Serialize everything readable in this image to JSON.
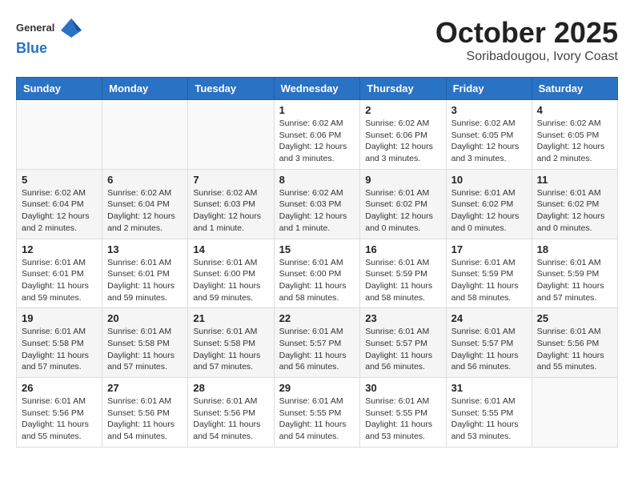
{
  "logo": {
    "general": "General",
    "blue": "Blue"
  },
  "header": {
    "month": "October 2025",
    "location": "Soribadougou, Ivory Coast"
  },
  "weekdays": [
    "Sunday",
    "Monday",
    "Tuesday",
    "Wednesday",
    "Thursday",
    "Friday",
    "Saturday"
  ],
  "weeks": [
    [
      {
        "day": "",
        "info": ""
      },
      {
        "day": "",
        "info": ""
      },
      {
        "day": "",
        "info": ""
      },
      {
        "day": "1",
        "info": "Sunrise: 6:02 AM\nSunset: 6:06 PM\nDaylight: 12 hours\nand 3 minutes."
      },
      {
        "day": "2",
        "info": "Sunrise: 6:02 AM\nSunset: 6:06 PM\nDaylight: 12 hours\nand 3 minutes."
      },
      {
        "day": "3",
        "info": "Sunrise: 6:02 AM\nSunset: 6:05 PM\nDaylight: 12 hours\nand 3 minutes."
      },
      {
        "day": "4",
        "info": "Sunrise: 6:02 AM\nSunset: 6:05 PM\nDaylight: 12 hours\nand 2 minutes."
      }
    ],
    [
      {
        "day": "5",
        "info": "Sunrise: 6:02 AM\nSunset: 6:04 PM\nDaylight: 12 hours\nand 2 minutes."
      },
      {
        "day": "6",
        "info": "Sunrise: 6:02 AM\nSunset: 6:04 PM\nDaylight: 12 hours\nand 2 minutes."
      },
      {
        "day": "7",
        "info": "Sunrise: 6:02 AM\nSunset: 6:03 PM\nDaylight: 12 hours\nand 1 minute."
      },
      {
        "day": "8",
        "info": "Sunrise: 6:02 AM\nSunset: 6:03 PM\nDaylight: 12 hours\nand 1 minute."
      },
      {
        "day": "9",
        "info": "Sunrise: 6:01 AM\nSunset: 6:02 PM\nDaylight: 12 hours\nand 0 minutes."
      },
      {
        "day": "10",
        "info": "Sunrise: 6:01 AM\nSunset: 6:02 PM\nDaylight: 12 hours\nand 0 minutes."
      },
      {
        "day": "11",
        "info": "Sunrise: 6:01 AM\nSunset: 6:02 PM\nDaylight: 12 hours\nand 0 minutes."
      }
    ],
    [
      {
        "day": "12",
        "info": "Sunrise: 6:01 AM\nSunset: 6:01 PM\nDaylight: 11 hours\nand 59 minutes."
      },
      {
        "day": "13",
        "info": "Sunrise: 6:01 AM\nSunset: 6:01 PM\nDaylight: 11 hours\nand 59 minutes."
      },
      {
        "day": "14",
        "info": "Sunrise: 6:01 AM\nSunset: 6:00 PM\nDaylight: 11 hours\nand 59 minutes."
      },
      {
        "day": "15",
        "info": "Sunrise: 6:01 AM\nSunset: 6:00 PM\nDaylight: 11 hours\nand 58 minutes."
      },
      {
        "day": "16",
        "info": "Sunrise: 6:01 AM\nSunset: 5:59 PM\nDaylight: 11 hours\nand 58 minutes."
      },
      {
        "day": "17",
        "info": "Sunrise: 6:01 AM\nSunset: 5:59 PM\nDaylight: 11 hours\nand 58 minutes."
      },
      {
        "day": "18",
        "info": "Sunrise: 6:01 AM\nSunset: 5:59 PM\nDaylight: 11 hours\nand 57 minutes."
      }
    ],
    [
      {
        "day": "19",
        "info": "Sunrise: 6:01 AM\nSunset: 5:58 PM\nDaylight: 11 hours\nand 57 minutes."
      },
      {
        "day": "20",
        "info": "Sunrise: 6:01 AM\nSunset: 5:58 PM\nDaylight: 11 hours\nand 57 minutes."
      },
      {
        "day": "21",
        "info": "Sunrise: 6:01 AM\nSunset: 5:58 PM\nDaylight: 11 hours\nand 57 minutes."
      },
      {
        "day": "22",
        "info": "Sunrise: 6:01 AM\nSunset: 5:57 PM\nDaylight: 11 hours\nand 56 minutes."
      },
      {
        "day": "23",
        "info": "Sunrise: 6:01 AM\nSunset: 5:57 PM\nDaylight: 11 hours\nand 56 minutes."
      },
      {
        "day": "24",
        "info": "Sunrise: 6:01 AM\nSunset: 5:57 PM\nDaylight: 11 hours\nand 56 minutes."
      },
      {
        "day": "25",
        "info": "Sunrise: 6:01 AM\nSunset: 5:56 PM\nDaylight: 11 hours\nand 55 minutes."
      }
    ],
    [
      {
        "day": "26",
        "info": "Sunrise: 6:01 AM\nSunset: 5:56 PM\nDaylight: 11 hours\nand 55 minutes."
      },
      {
        "day": "27",
        "info": "Sunrise: 6:01 AM\nSunset: 5:56 PM\nDaylight: 11 hours\nand 54 minutes."
      },
      {
        "day": "28",
        "info": "Sunrise: 6:01 AM\nSunset: 5:56 PM\nDaylight: 11 hours\nand 54 minutes."
      },
      {
        "day": "29",
        "info": "Sunrise: 6:01 AM\nSunset: 5:55 PM\nDaylight: 11 hours\nand 54 minutes."
      },
      {
        "day": "30",
        "info": "Sunrise: 6:01 AM\nSunset: 5:55 PM\nDaylight: 11 hours\nand 53 minutes."
      },
      {
        "day": "31",
        "info": "Sunrise: 6:01 AM\nSunset: 5:55 PM\nDaylight: 11 hours\nand 53 minutes."
      },
      {
        "day": "",
        "info": ""
      }
    ]
  ]
}
